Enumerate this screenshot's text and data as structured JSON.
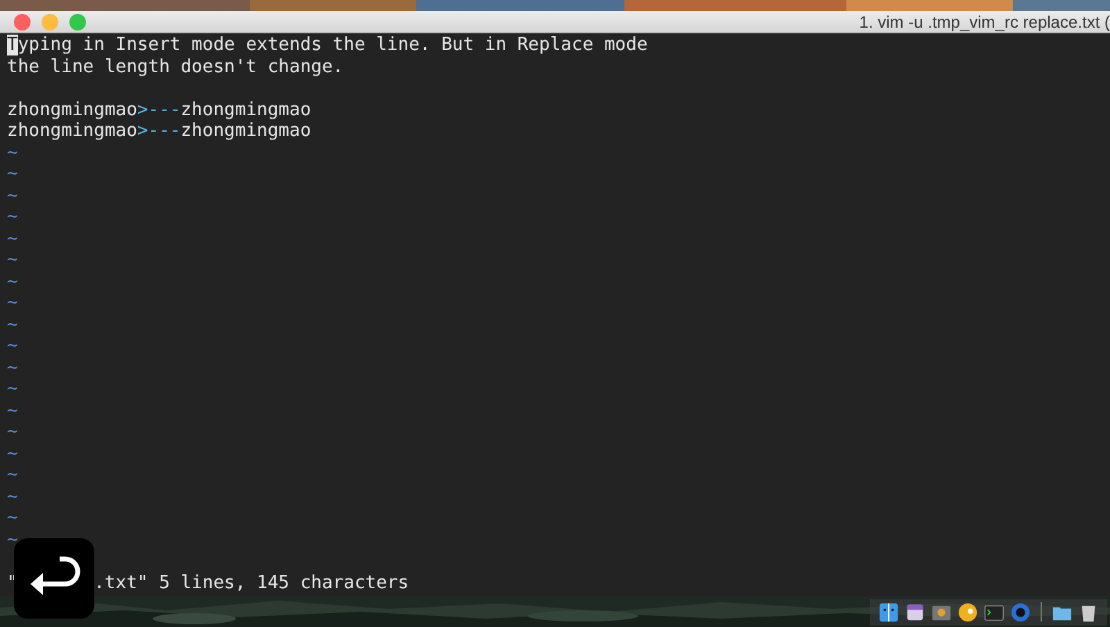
{
  "window": {
    "title": "1. vim -u .tmp_vim_rc replace.txt ("
  },
  "buffer": {
    "lines": [
      {
        "kind": "text",
        "segments": [
          {
            "kind": "cursor",
            "text": "T"
          },
          {
            "kind": "normal",
            "text": "yping in Insert mode extends the line. But in Replace mode"
          }
        ]
      },
      {
        "kind": "text",
        "segments": [
          {
            "kind": "normal",
            "text": "the line length doesn't change."
          }
        ]
      },
      {
        "kind": "blank"
      },
      {
        "kind": "text",
        "segments": [
          {
            "kind": "normal",
            "text": "zhongmingmao"
          },
          {
            "kind": "special",
            "text": ">---"
          },
          {
            "kind": "normal",
            "text": "zhongmingmao"
          }
        ]
      },
      {
        "kind": "text",
        "segments": [
          {
            "kind": "normal",
            "text": "zhongmingmao"
          },
          {
            "kind": "special",
            "text": ">---"
          },
          {
            "kind": "normal",
            "text": "zhongmingmao"
          }
        ]
      },
      {
        "kind": "tilde",
        "text": "~"
      },
      {
        "kind": "tilde",
        "text": "~"
      },
      {
        "kind": "tilde",
        "text": "~"
      },
      {
        "kind": "tilde",
        "text": "~"
      },
      {
        "kind": "tilde",
        "text": "~"
      },
      {
        "kind": "tilde",
        "text": "~"
      },
      {
        "kind": "tilde",
        "text": "~"
      },
      {
        "kind": "tilde",
        "text": "~"
      },
      {
        "kind": "tilde",
        "text": "~"
      },
      {
        "kind": "tilde",
        "text": "~"
      },
      {
        "kind": "tilde",
        "text": "~"
      },
      {
        "kind": "tilde",
        "text": "~"
      },
      {
        "kind": "tilde",
        "text": "~"
      },
      {
        "kind": "tilde",
        "text": "~"
      },
      {
        "kind": "tilde",
        "text": "~"
      },
      {
        "kind": "tilde",
        "text": "~"
      },
      {
        "kind": "tilde",
        "text": "~"
      },
      {
        "kind": "tilde",
        "text": "~"
      },
      {
        "kind": "tilde",
        "text": "~"
      }
    ]
  },
  "status_line": {
    "lead": "\"",
    "rest": ".txt\" 5 lines, 145 characters"
  }
}
